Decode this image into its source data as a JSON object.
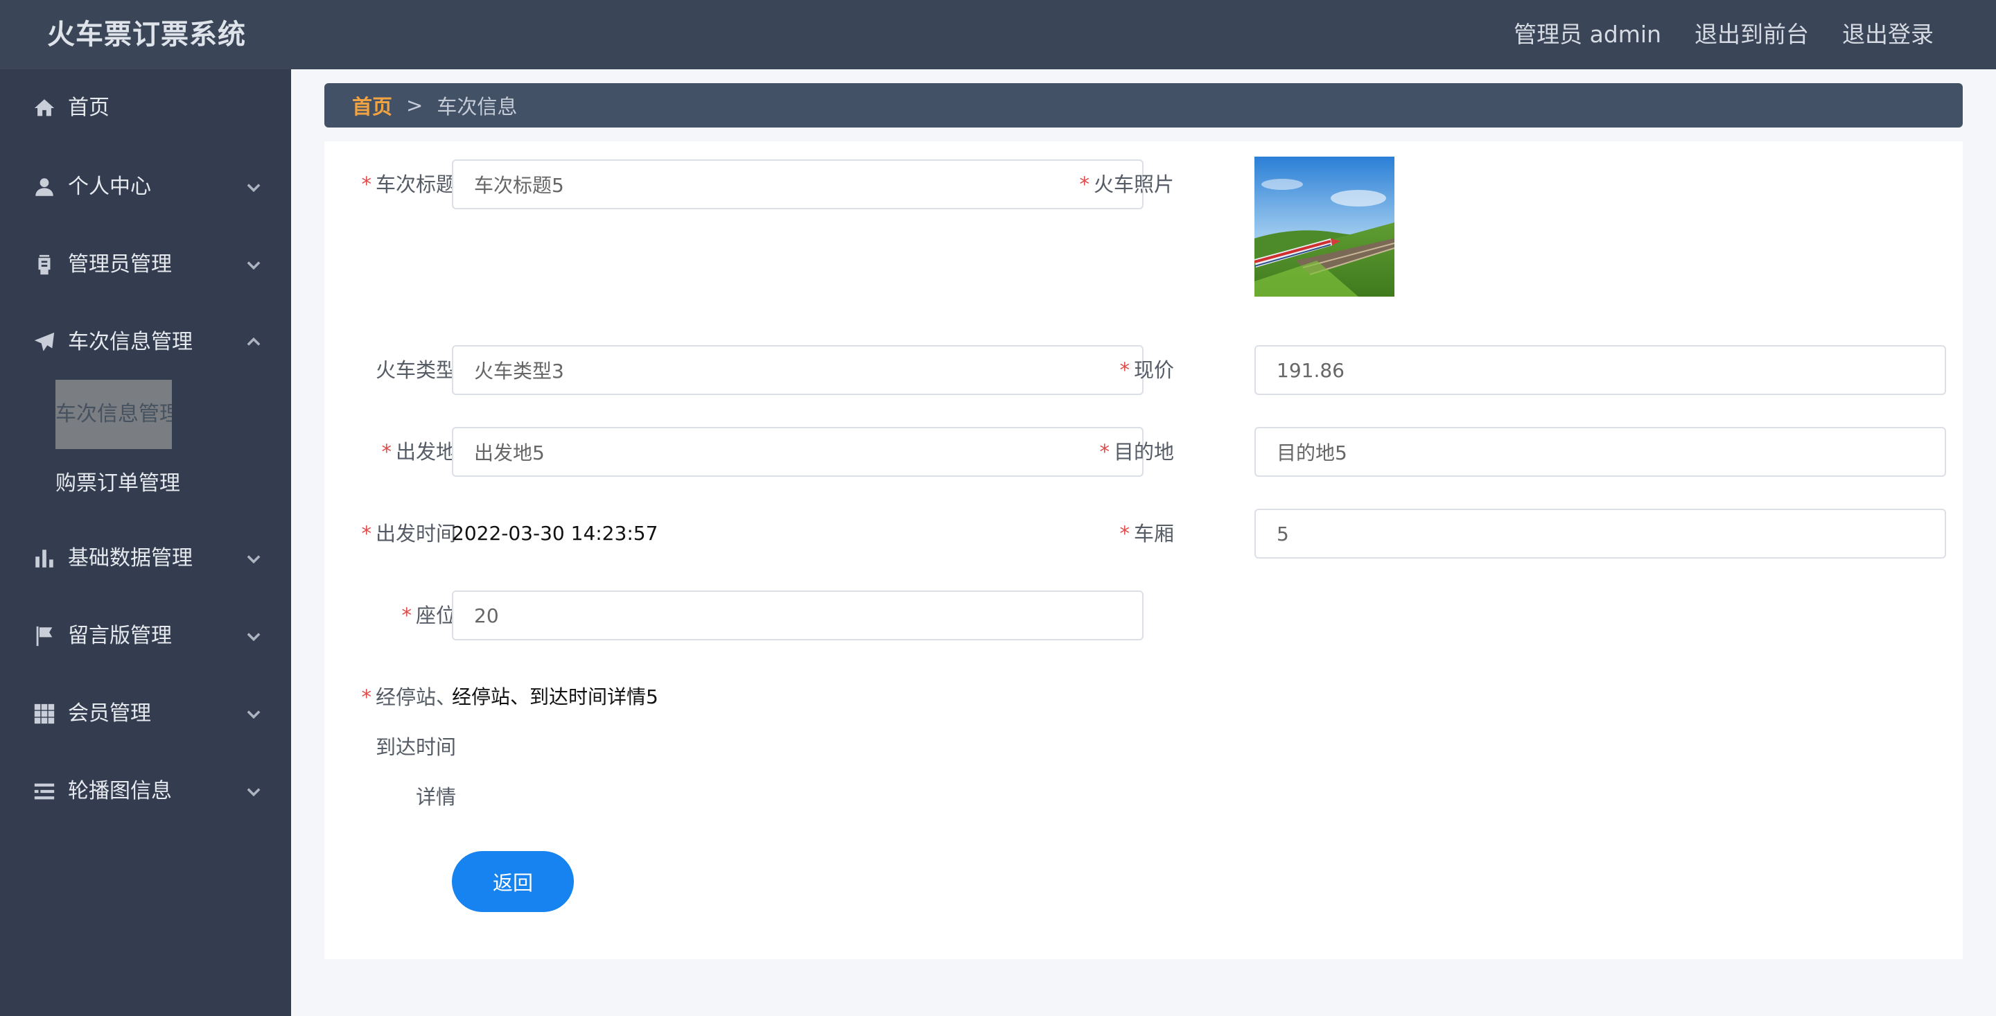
{
  "header": {
    "app_title": "火车票订票系统",
    "admin_label": "管理员 admin",
    "exit_front_label": "退出到前台",
    "logout_label": "退出登录"
  },
  "sidebar": {
    "items": [
      {
        "label": "首页",
        "icon": "home-icon"
      },
      {
        "label": "个人中心",
        "icon": "user-icon"
      },
      {
        "label": "管理员管理",
        "icon": "admin-icon"
      },
      {
        "label": "车次信息管理",
        "icon": "paper-plane-icon"
      },
      {
        "label": "基础数据管理",
        "icon": "bar-chart-icon"
      },
      {
        "label": "留言版管理",
        "icon": "flag-icon"
      },
      {
        "label": "会员管理",
        "icon": "grid-icon"
      },
      {
        "label": "轮播图信息",
        "icon": "list-icon"
      }
    ],
    "sub_items": [
      {
        "label": "车次信息管理",
        "active": true
      },
      {
        "label": "购票订单管理",
        "active": false
      }
    ]
  },
  "breadcrumb": {
    "home": "首页",
    "separator": ">",
    "current": "车次信息"
  },
  "form": {
    "title_label": "车次标题",
    "title_value": "车次标题5",
    "photo_label": "火车照片",
    "type_label": "火车类型",
    "type_value": "火车类型3",
    "price_label": "现价",
    "price_value": "191.86",
    "from_label": "出发地",
    "from_value": "出发地5",
    "to_label": "目的地",
    "to_value": "目的地5",
    "depart_label": "出发时间",
    "depart_value": "2022-03-30 14:23:57",
    "carriage_label": "车厢",
    "carriage_value": "5",
    "seat_label": "座位",
    "seat_value": "20",
    "stops_label_1": "经停站、",
    "stops_label_2": "到达时间",
    "stops_label_3": "详情",
    "stops_value": "经停站、到达时间详情5",
    "back_button": "返回"
  },
  "colors": {
    "header_bg": "#3a4558",
    "sidebar_bg": "#333d4f",
    "breadcrumb_bg": "#435167",
    "breadcrumb_home": "#f0a340",
    "required_star": "#e04b4b",
    "primary_button": "#1683f1"
  }
}
